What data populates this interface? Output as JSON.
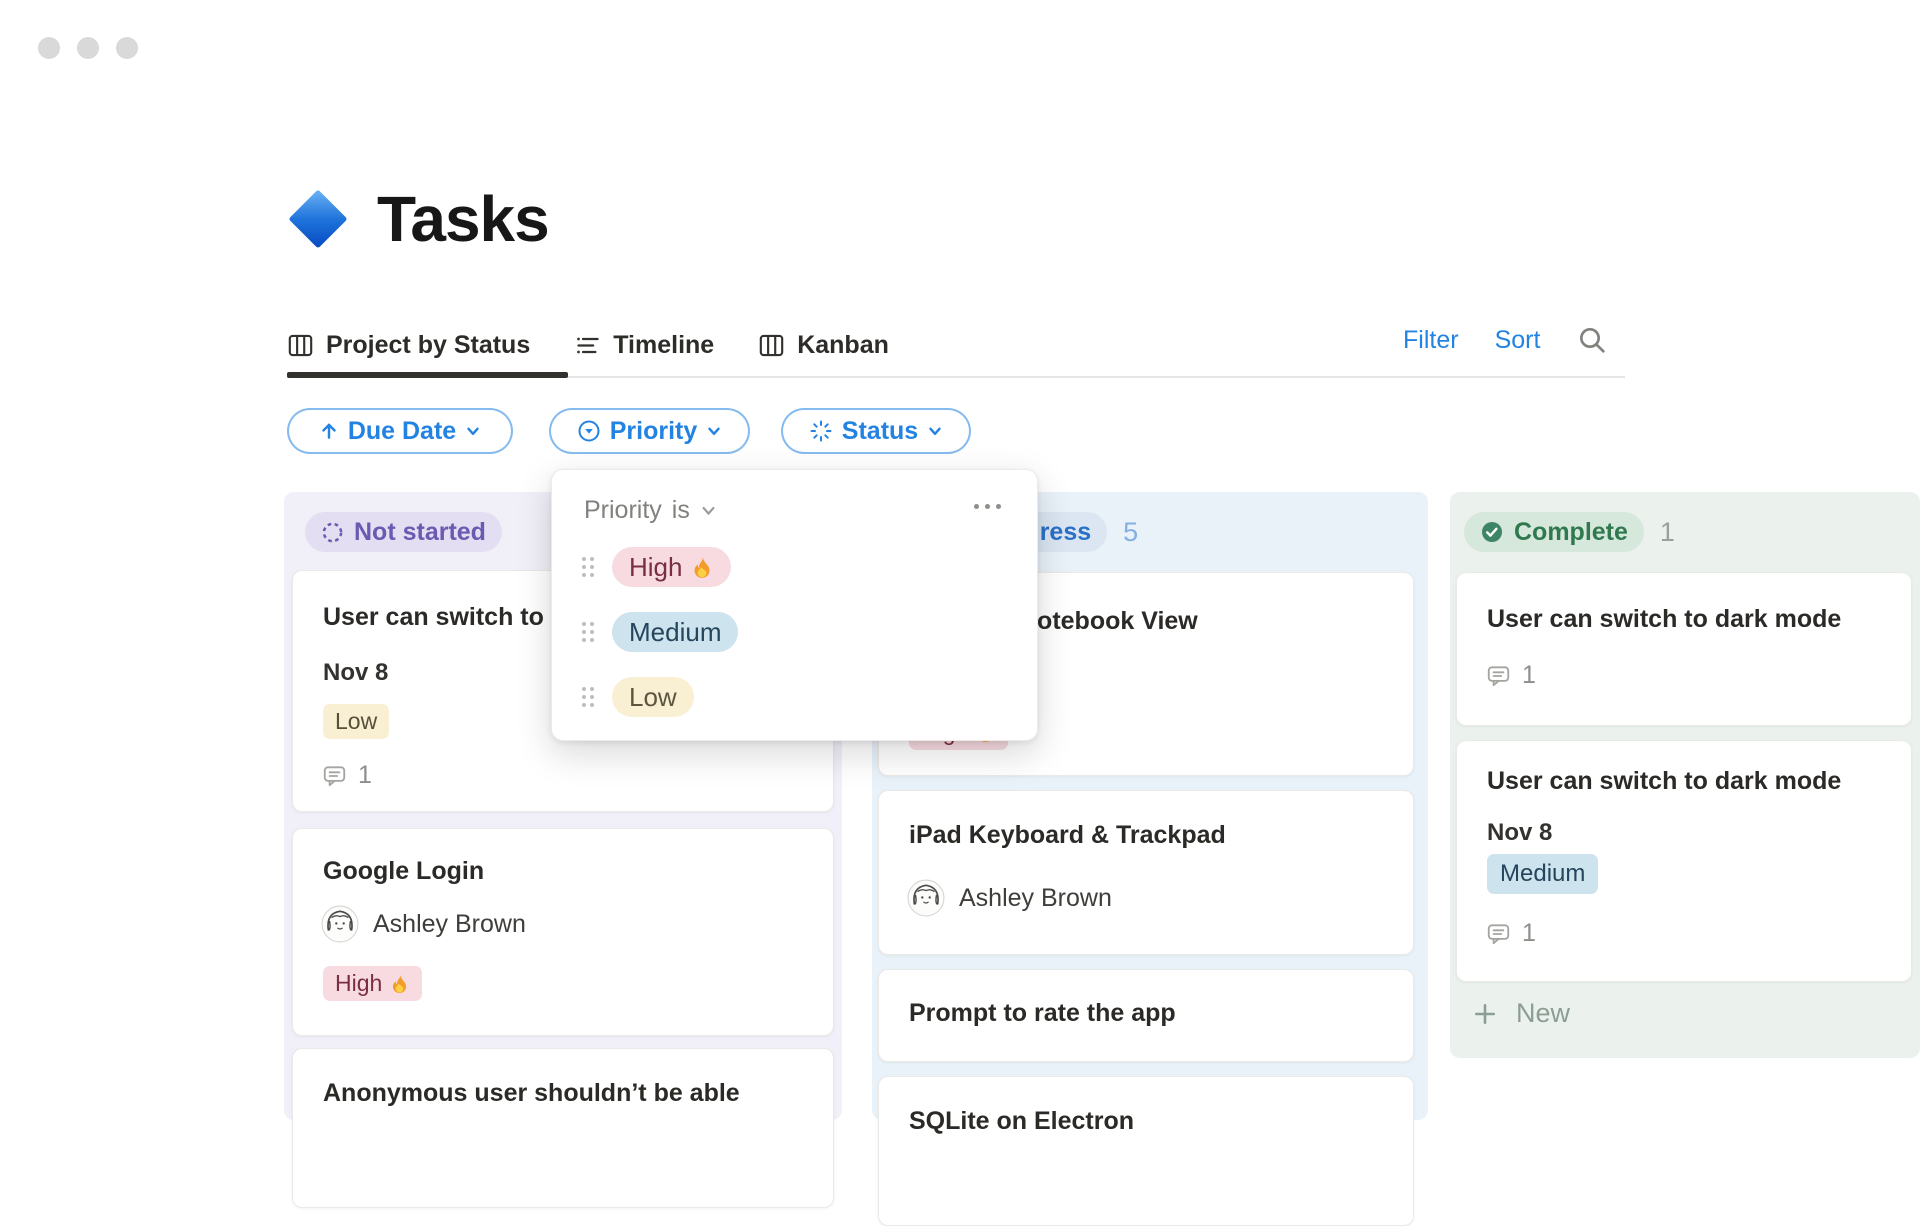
{
  "window": {
    "buttons": [
      "close",
      "minimize",
      "zoom"
    ]
  },
  "page": {
    "title": "Tasks",
    "icon": "blue-diamond-icon"
  },
  "tabs": [
    {
      "label": "Project by Status",
      "icon": "board-view-icon",
      "active": true
    },
    {
      "label": "Timeline",
      "icon": "timeline-view-icon",
      "active": false
    },
    {
      "label": "Kanban",
      "icon": "board-view-icon",
      "active": false
    }
  ],
  "actions": {
    "filter": "Filter",
    "sort": "Sort",
    "search_icon": "search-icon",
    "link_color": "#2383e2"
  },
  "filter_pills": [
    {
      "label": "Due Date",
      "icon": "arrow-up-icon",
      "chevron": "chevron-down-icon"
    },
    {
      "label": "Priority",
      "icon": "priority-circle-icon",
      "chevron": "chevron-down-icon"
    },
    {
      "label": "Status",
      "icon": "status-burst-icon",
      "chevron": "chevron-down-icon"
    }
  ],
  "priority_dropdown": {
    "field": "Priority",
    "operator": "is",
    "menu_icon": "ellipsis-icon",
    "options": [
      {
        "label": "High",
        "emoji": "flame-icon",
        "color": "#f7dbe1"
      },
      {
        "label": "Medium",
        "emoji": null,
        "color": "#cde3ee"
      },
      {
        "label": "Low",
        "emoji": null,
        "color": "#f9efd2"
      }
    ]
  },
  "board": {
    "columns": [
      {
        "label": "Not started",
        "status_icon": "dashed-circle-icon",
        "tint": "#f1eff7",
        "pill_bg": "#e3def1",
        "pill_text": "#6b59b2",
        "cards": [
          {
            "title": "User can switch to dark mode",
            "date": "Nov 8",
            "tag": {
              "label": "Low",
              "color": "yellow"
            },
            "comments": "1"
          },
          {
            "title": "Google Login",
            "person": "Ashley Brown",
            "tag": {
              "label": "High",
              "color": "pink",
              "emoji": "flame-icon"
            }
          },
          {
            "title": "Anonymous user shouldn’t be able"
          }
        ]
      },
      {
        "label": "In progress",
        "status_icon": "progress-circle-icon",
        "count": "5",
        "tint": "#e9f1f9",
        "pill_bg": "#dbe6f2",
        "pill_text": "#2a6fc9",
        "cards": [
          {
            "title": "Notebook View",
            "tag": {
              "label": "High",
              "color": "pink",
              "emoji": "flame-icon"
            }
          },
          {
            "title": "iPad Keyboard & Trackpad",
            "person": "Ashley Brown"
          },
          {
            "title": "Prompt to rate the app"
          },
          {
            "title": "SQLite on Electron"
          }
        ]
      },
      {
        "label": "Complete",
        "status_icon": "check-circle-icon",
        "count": "1",
        "tint": "#ebf2ee",
        "pill_bg": "#d6e7dc",
        "pill_text": "#30794f",
        "new_button": "New",
        "cards": [
          {
            "title": "User can switch to dark mode",
            "comments": "1"
          },
          {
            "title": "User can switch to dark mode",
            "date": "Nov 8",
            "tag": {
              "label": "Medium",
              "color": "blue"
            },
            "comments": "1"
          }
        ]
      }
    ]
  }
}
